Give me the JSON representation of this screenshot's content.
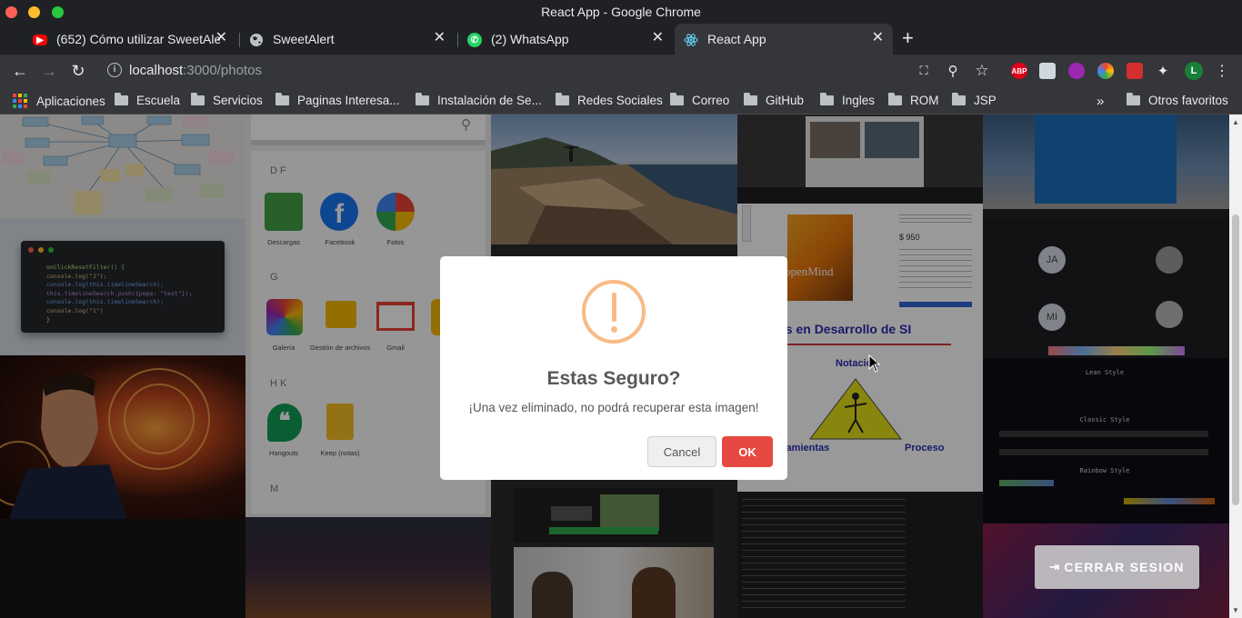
{
  "window": {
    "title": "React App - Google Chrome",
    "traffic_colors": [
      "#fe5f57",
      "#febc2e",
      "#28c840"
    ]
  },
  "tabs": [
    {
      "label": "(652) Cómo utilizar SweetAlert",
      "favicon": "youtube-icon",
      "active": false
    },
    {
      "label": "SweetAlert",
      "favicon": "globe-icon",
      "active": false
    },
    {
      "label": "(2) WhatsApp",
      "favicon": "whatsapp-icon",
      "active": false
    },
    {
      "label": "React App",
      "favicon": "react-icon",
      "active": true
    }
  ],
  "address": {
    "host": "localhost",
    "path": ":3000/photos"
  },
  "bookmarks": {
    "apps_label": "Aplicaciones",
    "folders": [
      "Escuela",
      "Servicios",
      "Paginas Interesa...",
      "Instalación de Se...",
      "Redes Sociales",
      "Correo",
      "GitHub",
      "Ingles",
      "ROM",
      "JSP"
    ],
    "other": "Otros favoritos"
  },
  "extensions": {
    "avatar_letter": "L",
    "abp_label": "ABP"
  },
  "photo_texts": {
    "phone_section_df": "D F",
    "phone_section_g": "G",
    "phone_section_hk": "H K",
    "phone_section_m": "M",
    "phone_apps": [
      "Descargas",
      "Facebook",
      "Fotos",
      "Galería",
      "Gestión de archivos",
      "Gmail",
      "Hangouts",
      "Keep (notas)"
    ],
    "slide_title": "es en Desarrollo de SI",
    "slide_notacion": "Notación",
    "slide_herramientas": "rramientas",
    "slide_proceso": "Proceso",
    "slide_price": "$ 950",
    "slide_book": "openMind",
    "meet_ja": "JA",
    "meet_mi": "MI",
    "terminal_lean": "Lean Style",
    "terminal_classic": "Classic Style",
    "terminal_rainbow": "Rainbow Style"
  },
  "code_snippet": [
    "onClickResetFilter() {",
    "  console.log(\"J\");",
    "  console.log(this.timelineSearch);",
    "  this.timelineSearch.push({pepe: \"test\"});",
    "  console.log(this.timelineSearch);",
    "  console.log(\"1\")",
    "}"
  ],
  "modal": {
    "title": "Estas Seguro?",
    "text": "¡Una vez eliminado, no podrá recuperar esta imagen!",
    "cancel": "Cancel",
    "ok": "OK",
    "warn_color": "#f8bb86",
    "ok_color": "#e64942"
  },
  "logout": {
    "label": "CERRAR SESION"
  }
}
